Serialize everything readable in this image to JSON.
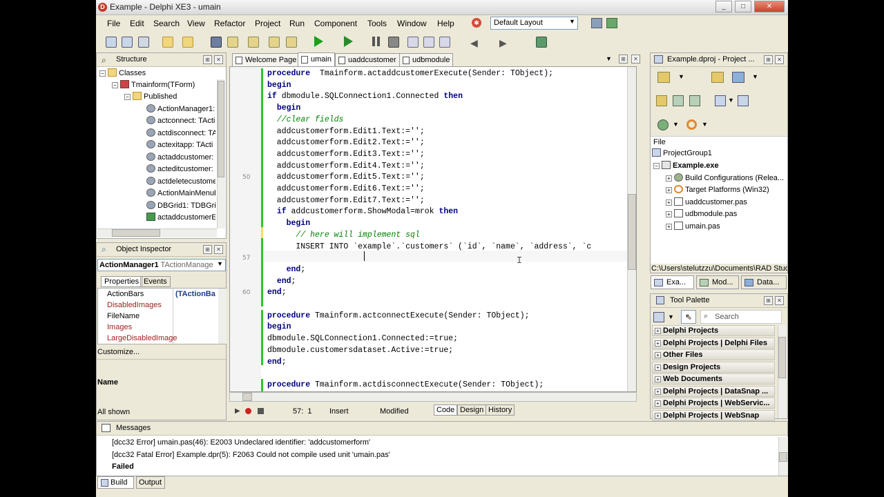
{
  "window": {
    "title": "Example - Delphi XE3 - umain"
  },
  "menu": [
    "File",
    "Edit",
    "Search",
    "View",
    "Refactor",
    "Project",
    "Run",
    "Component",
    "Tools",
    "Window",
    "Help"
  ],
  "layout": {
    "selected": "Default Layout"
  },
  "structure": {
    "title": "Structure",
    "items": [
      "Classes",
      "Tmainform(TForm)",
      "Published",
      "ActionManager1:",
      "actconnect: TActi",
      "actdisconnect: TA",
      "actexitapp: TActi",
      "actaddcustomer:",
      "acteditcustomer:",
      "actdeletecustome",
      "ActionMainMenuB",
      "DBGrid1: TDBGrid",
      "actaddcustomerE"
    ]
  },
  "object_inspector": {
    "title": "Object Inspector",
    "selected": "ActionManager1",
    "selected_type": "TActionManage",
    "tabs": [
      "Properties",
      "Events"
    ],
    "properties": [
      "ActionBars",
      "DisabledImages",
      "FileName",
      "Images",
      "LargeDisabledImage"
    ],
    "first_value": "(TActionBa",
    "customize": "Customize...",
    "name_label": "Name",
    "all_shown": "All shown"
  },
  "editor": {
    "tabs": [
      "Welcome Page",
      "umain",
      "uaddcustomer",
      "udbmodule"
    ],
    "lines": [
      {
        "parts": [
          [
            "kw",
            "procedure"
          ],
          [
            "",
            "  Tmainform.actaddcustomerExecute(Sender: TObject);"
          ]
        ]
      },
      {
        "parts": [
          [
            "kw",
            "begin"
          ]
        ]
      },
      {
        "parts": [
          [
            "kw",
            "if"
          ],
          [
            "",
            " dbmodule.SQLConnection1.Connected "
          ],
          [
            "kw",
            "then"
          ]
        ]
      },
      {
        "parts": [
          [
            "",
            "  "
          ],
          [
            "kw",
            "begin"
          ]
        ]
      },
      {
        "parts": [
          [
            "",
            "  "
          ],
          [
            "cm",
            "//clear fields"
          ]
        ]
      },
      {
        "parts": [
          [
            "",
            "  addcustomerform.Edit1.Text:='';"
          ]
        ]
      },
      {
        "parts": [
          [
            "",
            "  addcustomerform.Edit2.Text:='';"
          ]
        ]
      },
      {
        "parts": [
          [
            "",
            "  addcustomerform.Edit3.Text:='';"
          ]
        ]
      },
      {
        "parts": [
          [
            "",
            "  addcustomerform.Edit4.Text:='';"
          ]
        ]
      },
      {
        "parts": [
          [
            "",
            "  addcustomerform.Edit5.Text:='';"
          ]
        ]
      },
      {
        "parts": [
          [
            "",
            "  addcustomerform.Edit6.Text:='';"
          ]
        ]
      },
      {
        "parts": [
          [
            "",
            "  addcustomerform.Edit7.Text:='';"
          ]
        ]
      },
      {
        "parts": [
          [
            "",
            "  "
          ],
          [
            "kw",
            "if"
          ],
          [
            "",
            " addcustomerform.ShowModal=mrok "
          ],
          [
            "kw",
            "then"
          ]
        ]
      },
      {
        "parts": [
          [
            "",
            "    "
          ],
          [
            "kw",
            "begin"
          ]
        ]
      },
      {
        "parts": [
          [
            "",
            "      "
          ],
          [
            "cm",
            "// here will implement sql"
          ]
        ]
      },
      {
        "parts": [
          [
            "",
            "      INSERT INTO `example`.`customers` (`id`, `name`, `address`, `c"
          ]
        ]
      },
      {
        "parts": [
          [
            "",
            ""
          ]
        ]
      },
      {
        "parts": [
          [
            "",
            "    "
          ],
          [
            "kw",
            "end"
          ],
          [
            "",
            ";"
          ]
        ]
      },
      {
        "parts": [
          [
            "",
            "  "
          ],
          [
            "kw",
            "end"
          ],
          [
            "",
            ";"
          ]
        ]
      },
      {
        "parts": [
          [
            "kw",
            "end"
          ],
          [
            "",
            ";"
          ]
        ]
      },
      {
        "parts": [
          [
            "",
            ""
          ]
        ]
      },
      {
        "parts": [
          [
            "kw",
            "procedure"
          ],
          [
            "",
            " Tmainform.actconnectExecute(Sender: TObject);"
          ]
        ]
      },
      {
        "parts": [
          [
            "kw",
            "begin"
          ]
        ]
      },
      {
        "parts": [
          [
            "",
            "dbmodule.SQLConnection1.Connected:=true;"
          ]
        ]
      },
      {
        "parts": [
          [
            "",
            "dbmodule.customersdataset.Active:=true;"
          ]
        ]
      },
      {
        "parts": [
          [
            "kw",
            "end"
          ],
          [
            "",
            ";"
          ]
        ]
      },
      {
        "parts": [
          [
            "",
            ""
          ]
        ]
      },
      {
        "parts": [
          [
            "kw",
            "procedure"
          ],
          [
            "",
            " Tmainform.actdisconnectExecute(Sender: TObject);"
          ]
        ]
      }
    ],
    "line_numbers": [
      "50",
      "57",
      "60"
    ],
    "status": {
      "position": "57:  1",
      "mode": "Insert",
      "state": "Modified"
    },
    "bottom_tabs": [
      "Code",
      "Design",
      "History"
    ]
  },
  "project": {
    "title": "Example.dproj - Project ...",
    "file_label": "File",
    "items": [
      "ProjectGroup1",
      "Example.exe",
      "Build Configurations (Relea...",
      "Target Platforms (Win32)",
      "uaddcustomer.pas",
      "udbmodule.pas",
      "umain.pas"
    ],
    "path": "C:\\Users\\stelutzzu\\Documents\\RAD Studio",
    "tabs": [
      "Exa...",
      "Mod...",
      "Data..."
    ]
  },
  "tool_palette": {
    "title": "Tool Palette",
    "search_placeholder": "Search",
    "categories": [
      "Delphi Projects",
      "Delphi Projects | Delphi Files",
      "Other Files",
      "Design Projects",
      "Web Documents",
      "Delphi Projects | DataSnap ...",
      "Delphi Projects | WebServic...",
      "Delphi Projects | WebSnap"
    ]
  },
  "messages": {
    "title": "Messages",
    "lines": [
      "[dcc32 Error] umain.pas(46): E2003 Undeclared identifier: 'addcustomerform'",
      "[dcc32 Fatal Error] Example.dpr(5): F2063 Could not compile used unit 'umain.pas'",
      "Failed"
    ],
    "tabs": [
      "Build",
      "Output"
    ]
  }
}
